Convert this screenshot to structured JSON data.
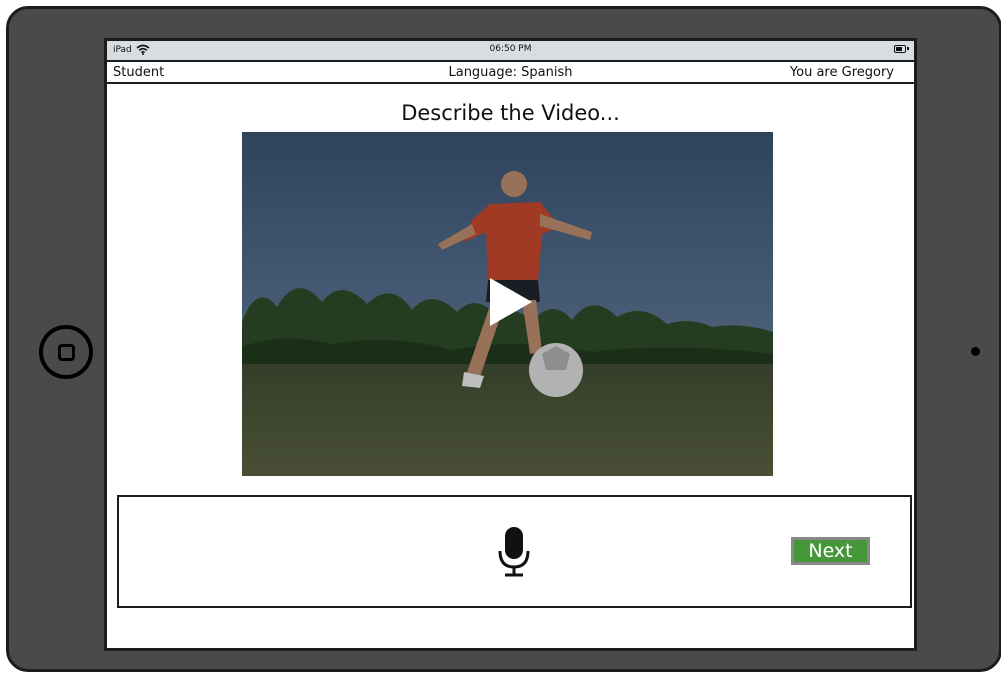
{
  "status_bar": {
    "carrier": "iPad",
    "time": "06:50 PM",
    "icons": [
      "wifi-icon",
      "battery-icon"
    ]
  },
  "nav_bar": {
    "left": "Student",
    "center": "Language: Spanish",
    "right": "You are Gregory"
  },
  "prompt": {
    "title": "Describe the Video..."
  },
  "video": {
    "icon": "play-icon"
  },
  "record_panel": {
    "mic_icon": "microphone-icon",
    "next_label": "Next",
    "next_color": "#46973a"
  },
  "colors": {
    "device_frame": "#4a4a4a",
    "status_bar_bg": "#d7dde1"
  }
}
